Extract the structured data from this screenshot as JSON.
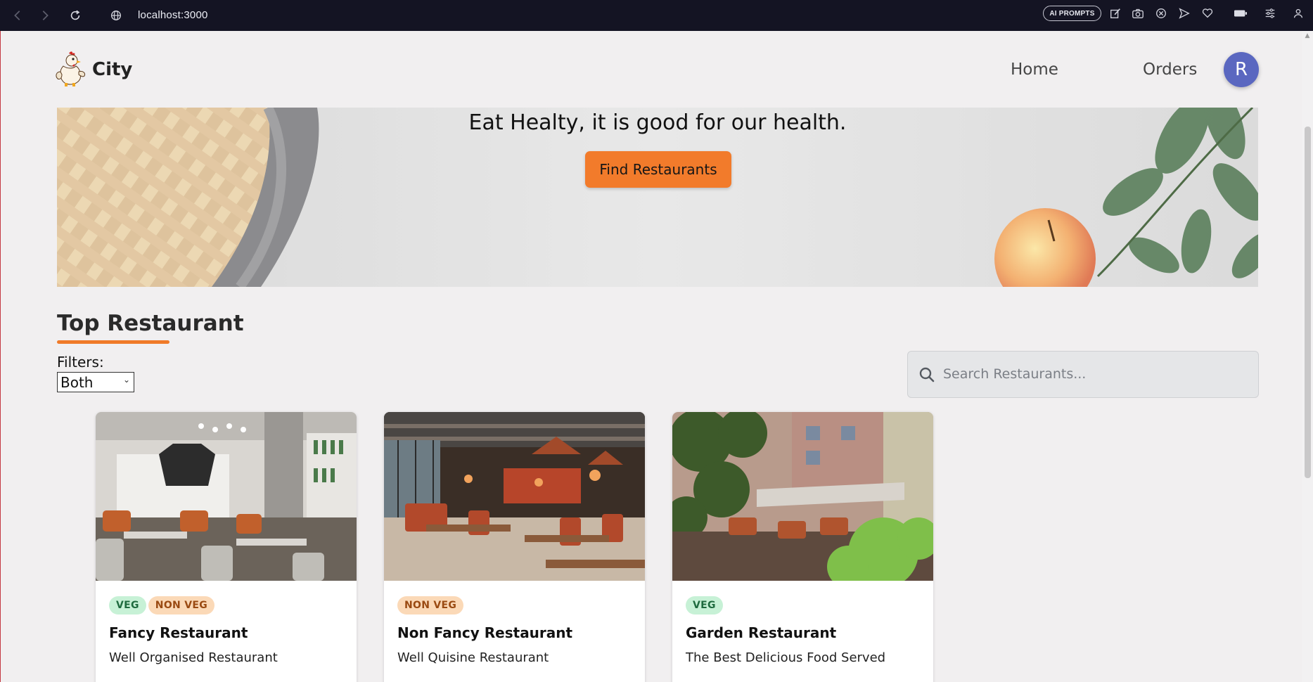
{
  "browser": {
    "url": "localhost:3000",
    "ai_badge": "AI PROMPTS",
    "icons": [
      "back-icon",
      "forward-icon",
      "reload-icon",
      "site-info-icon",
      "edit-icon",
      "camera-icon",
      "close-circle-icon",
      "send-icon",
      "heart-icon",
      "battery-icon",
      "sliders-icon",
      "profile-icon"
    ]
  },
  "header": {
    "brand": "City",
    "nav": {
      "home": "Home",
      "orders": "Orders"
    },
    "avatar_letter": "R"
  },
  "hero": {
    "title": "Eat Healty, it is good for our health.",
    "cta": "Find Restaurants"
  },
  "section": {
    "title": "Top Restaurant",
    "filters_label": "Filters:",
    "filter_value": "Both",
    "search_placeholder": "Search Restaurants..."
  },
  "restaurants": [
    {
      "name": "Fancy Restaurant",
      "description": "Well Organised Restaurant",
      "tags": [
        "VEG",
        "NON VEG"
      ]
    },
    {
      "name": "Non Fancy Restaurant",
      "description": "Well Quisine Restaurant",
      "tags": [
        "NON VEG"
      ]
    },
    {
      "name": "Garden Restaurant",
      "description": "The Best Delicious Food Served",
      "tags": [
        "VEG"
      ]
    }
  ],
  "colors": {
    "accent": "#f27b2b",
    "avatar": "#5a67c0",
    "veg_bg": "#c7f1d6",
    "nonveg_bg": "#fbd9b7",
    "browser_bar": "#141423"
  }
}
